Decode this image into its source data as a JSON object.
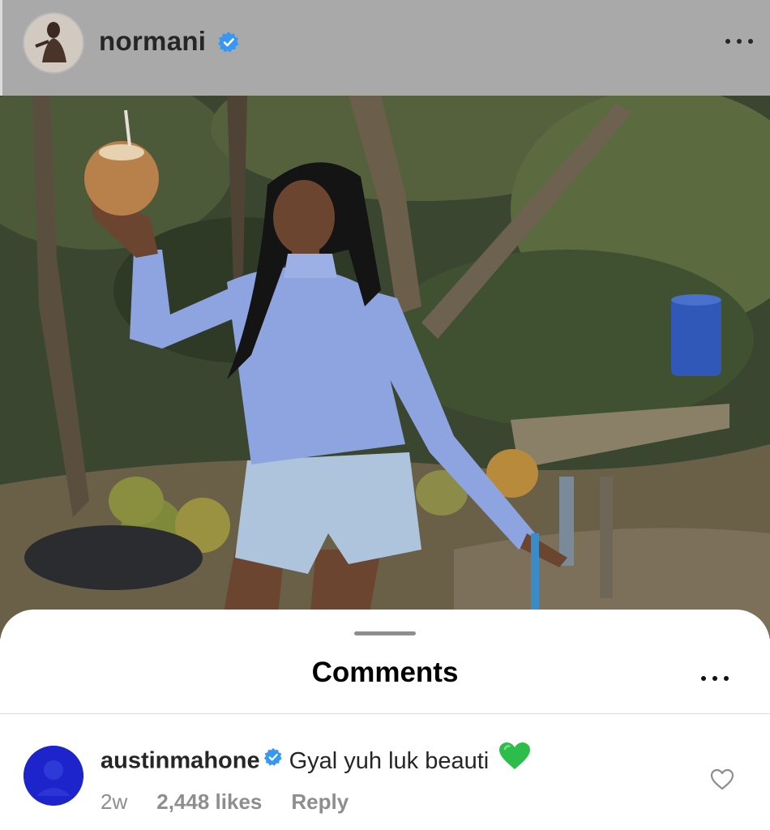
{
  "post": {
    "username": "normani",
    "verified": true,
    "avatar_icon": "profile-photo",
    "more_icon": "ellipsis-icon"
  },
  "photo": {
    "description_icon": "photo-content"
  },
  "comments_sheet": {
    "title": "Comments",
    "more_icon": "ellipsis-icon",
    "comments": [
      {
        "username": "austinmahone",
        "verified": true,
        "text": "Gyal yuh luk beauti",
        "emoji": "green-heart-emoji",
        "time": "2w",
        "likes": "2,448 likes",
        "reply_label": "Reply",
        "like_icon": "heart-outline-icon"
      }
    ]
  },
  "colors": {
    "verified_blue": "#3897f0",
    "header_dim": "#a9a9a9",
    "meta_gray": "#8e8e8e",
    "green_heart": "#2dbd4a"
  }
}
